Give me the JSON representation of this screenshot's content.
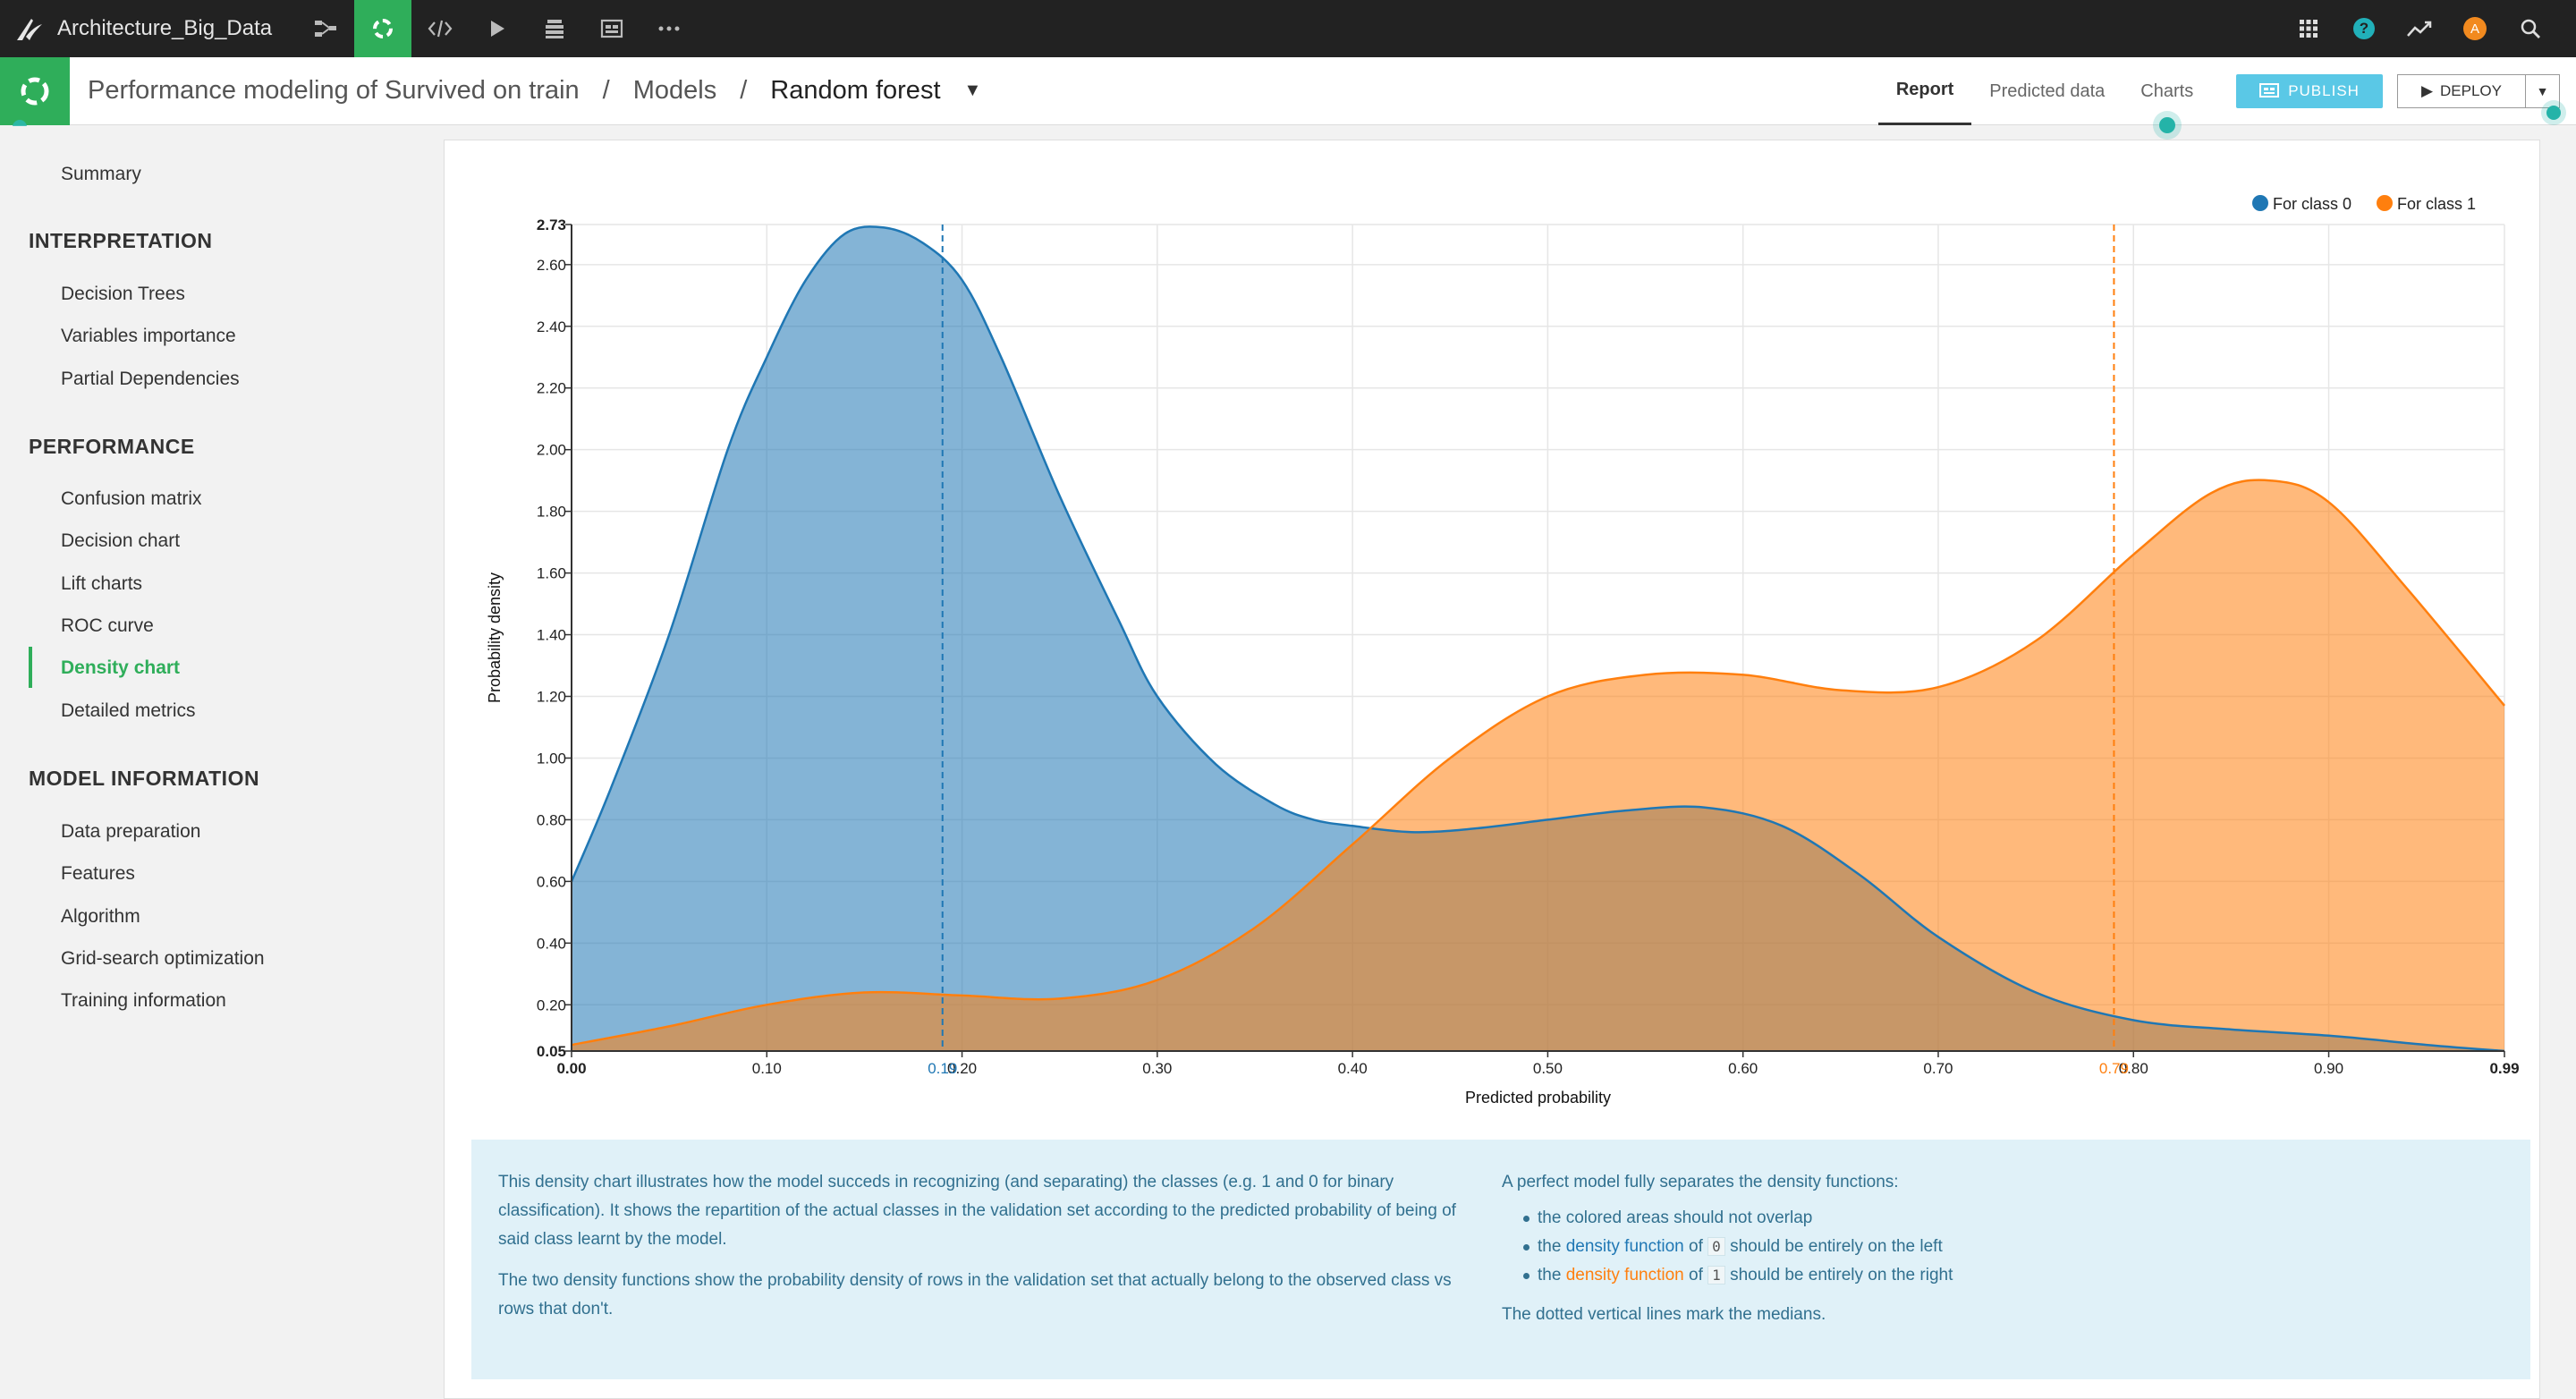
{
  "topbar": {
    "project_name": "Architecture_Big_Data"
  },
  "breadcrumb": {
    "analysis": "Performance modeling of Survived on train",
    "sep1": "/",
    "models": "Models",
    "sep2": "/",
    "current": "Random forest"
  },
  "tabs": {
    "report": "Report",
    "predicted": "Predicted data",
    "charts": "Charts"
  },
  "buttons": {
    "publish": "PUBLISH",
    "deploy": "DEPLOY"
  },
  "sidebar": {
    "summary": "Summary",
    "interpretation_header": "INTERPRETATION",
    "interpretation": [
      "Decision Trees",
      "Variables importance",
      "Partial Dependencies"
    ],
    "performance_header": "PERFORMANCE",
    "performance": [
      "Confusion matrix",
      "Decision chart",
      "Lift charts",
      "ROC curve",
      "Density chart",
      "Detailed metrics"
    ],
    "model_header": "MODEL INFORMATION",
    "model": [
      "Data preparation",
      "Features",
      "Algorithm",
      "Grid-search optimization",
      "Training information"
    ],
    "active_item": "Density chart"
  },
  "colors": {
    "class0": "#1f77b4",
    "class1": "#ff7f0e",
    "accent": "#2fae5a",
    "info_bg": "#e0f1f8"
  },
  "chart_data": {
    "type": "area",
    "xlabel": "Predicted probability",
    "ylabel": "Probability density",
    "xlim": [
      0.0,
      0.99
    ],
    "ylim": [
      0.05,
      2.73
    ],
    "x_ticks": [
      "0.00",
      "0.10",
      "0.20",
      "0.30",
      "0.40",
      "0.50",
      "0.60",
      "0.70",
      "0.80",
      "0.90",
      "0.99"
    ],
    "y_ticks": [
      "0.05",
      "0.20",
      "0.40",
      "0.60",
      "0.80",
      "1.00",
      "1.20",
      "1.40",
      "1.60",
      "1.80",
      "2.00",
      "2.20",
      "2.40",
      "2.60",
      "2.73"
    ],
    "grid": true,
    "legend_position": "top-right",
    "series": [
      {
        "name": "For class 0",
        "median": 0.19,
        "median_label": "0.19",
        "x": [
          0.0,
          0.02,
          0.05,
          0.08,
          0.1,
          0.12,
          0.14,
          0.16,
          0.18,
          0.2,
          0.22,
          0.25,
          0.28,
          0.3,
          0.33,
          0.36,
          0.38,
          0.4,
          0.43,
          0.46,
          0.5,
          0.54,
          0.58,
          0.62,
          0.66,
          0.7,
          0.75,
          0.8,
          0.85,
          0.9,
          0.95,
          0.99
        ],
        "y": [
          0.6,
          0.9,
          1.4,
          2.0,
          2.3,
          2.55,
          2.7,
          2.72,
          2.67,
          2.55,
          2.3,
          1.85,
          1.45,
          1.2,
          0.98,
          0.85,
          0.8,
          0.78,
          0.76,
          0.77,
          0.8,
          0.83,
          0.84,
          0.78,
          0.62,
          0.42,
          0.24,
          0.15,
          0.12,
          0.1,
          0.07,
          0.05
        ]
      },
      {
        "name": "For class 1",
        "median": 0.79,
        "median_label": "0.79",
        "x": [
          0.0,
          0.05,
          0.1,
          0.15,
          0.2,
          0.25,
          0.3,
          0.35,
          0.4,
          0.45,
          0.5,
          0.55,
          0.6,
          0.65,
          0.7,
          0.75,
          0.8,
          0.84,
          0.87,
          0.9,
          0.94,
          0.99
        ],
        "y": [
          0.07,
          0.13,
          0.2,
          0.24,
          0.23,
          0.22,
          0.28,
          0.45,
          0.72,
          1.0,
          1.2,
          1.27,
          1.27,
          1.22,
          1.23,
          1.38,
          1.66,
          1.86,
          1.9,
          1.83,
          1.55,
          1.17
        ]
      }
    ]
  },
  "info": {
    "left_p1": "This density chart illustrates how the model succeds in recognizing (and separating) the classes (e.g. 1 and 0 for binary classification). It shows the repartition of the actual classes in the validation set according to the predicted probability of being of said class learnt by the model.",
    "left_p2": "The two density functions show the probability density of rows in the validation set that actually belong to the observed class vs rows that don't.",
    "right_title": "A perfect model fully separates the density functions:",
    "b1": "the colored areas should not overlap",
    "b_the": "the",
    "b_density": "density function",
    "b_of": "of",
    "b2_code": "0",
    "b2_tail": "should be entirely on the left",
    "b3_code": "1",
    "b3_tail": "should be entirely on the right",
    "footer": "The dotted vertical lines mark the medians."
  }
}
